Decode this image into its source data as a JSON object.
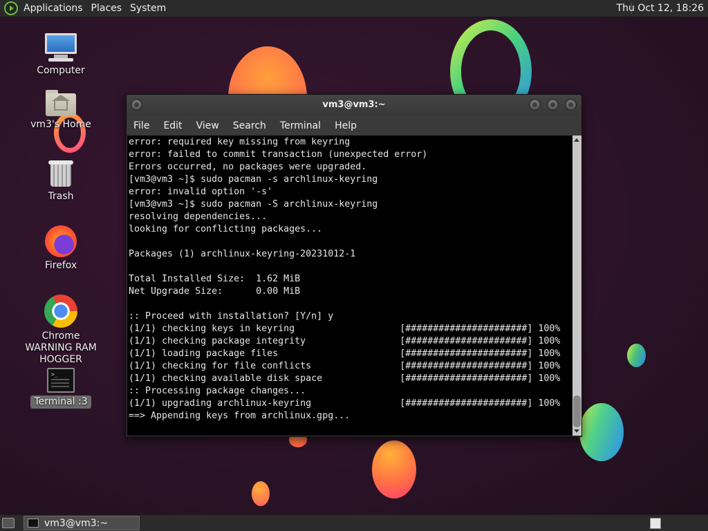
{
  "top_panel": {
    "menus": [
      "Applications",
      "Places",
      "System"
    ],
    "clock": "Thu Oct 12, 18:26"
  },
  "desktop_icons": [
    {
      "label": "Computer"
    },
    {
      "label": "vm3's Home"
    },
    {
      "label": "Trash"
    },
    {
      "label": "Firefox"
    },
    {
      "label": "Chrome WARNING RAM HOGGER"
    },
    {
      "label": "Terminal :3"
    }
  ],
  "window": {
    "title": "vm3@vm3:~",
    "menus": [
      "File",
      "Edit",
      "View",
      "Search",
      "Terminal",
      "Help"
    ],
    "terminal_lines": [
      "error: required key missing from keyring",
      "error: failed to commit transaction (unexpected error)",
      "Errors occurred, no packages were upgraded.",
      "[vm3@vm3 ~]$ sudo pacman -s archlinux-keyring",
      "error: invalid option '-s'",
      "[vm3@vm3 ~]$ sudo pacman -S archlinux-keyring",
      "resolving dependencies...",
      "looking for conflicting packages...",
      "",
      "Packages (1) archlinux-keyring-20231012-1",
      "",
      "Total Installed Size:  1.62 MiB",
      "Net Upgrade Size:      0.00 MiB",
      "",
      ":: Proceed with installation? [Y/n] y",
      "(1/1) checking keys in keyring                   [######################] 100%",
      "(1/1) checking package integrity                 [######################] 100%",
      "(1/1) loading package files                      [######################] 100%",
      "(1/1) checking for file conflicts                [######################] 100%",
      "(1/1) checking available disk space              [######################] 100%",
      ":: Processing package changes...",
      "(1/1) upgrading archlinux-keyring                [######################] 100%",
      "==> Appending keys from archlinux.gpg..."
    ]
  },
  "taskbar": {
    "task_label": "vm3@vm3:~"
  }
}
